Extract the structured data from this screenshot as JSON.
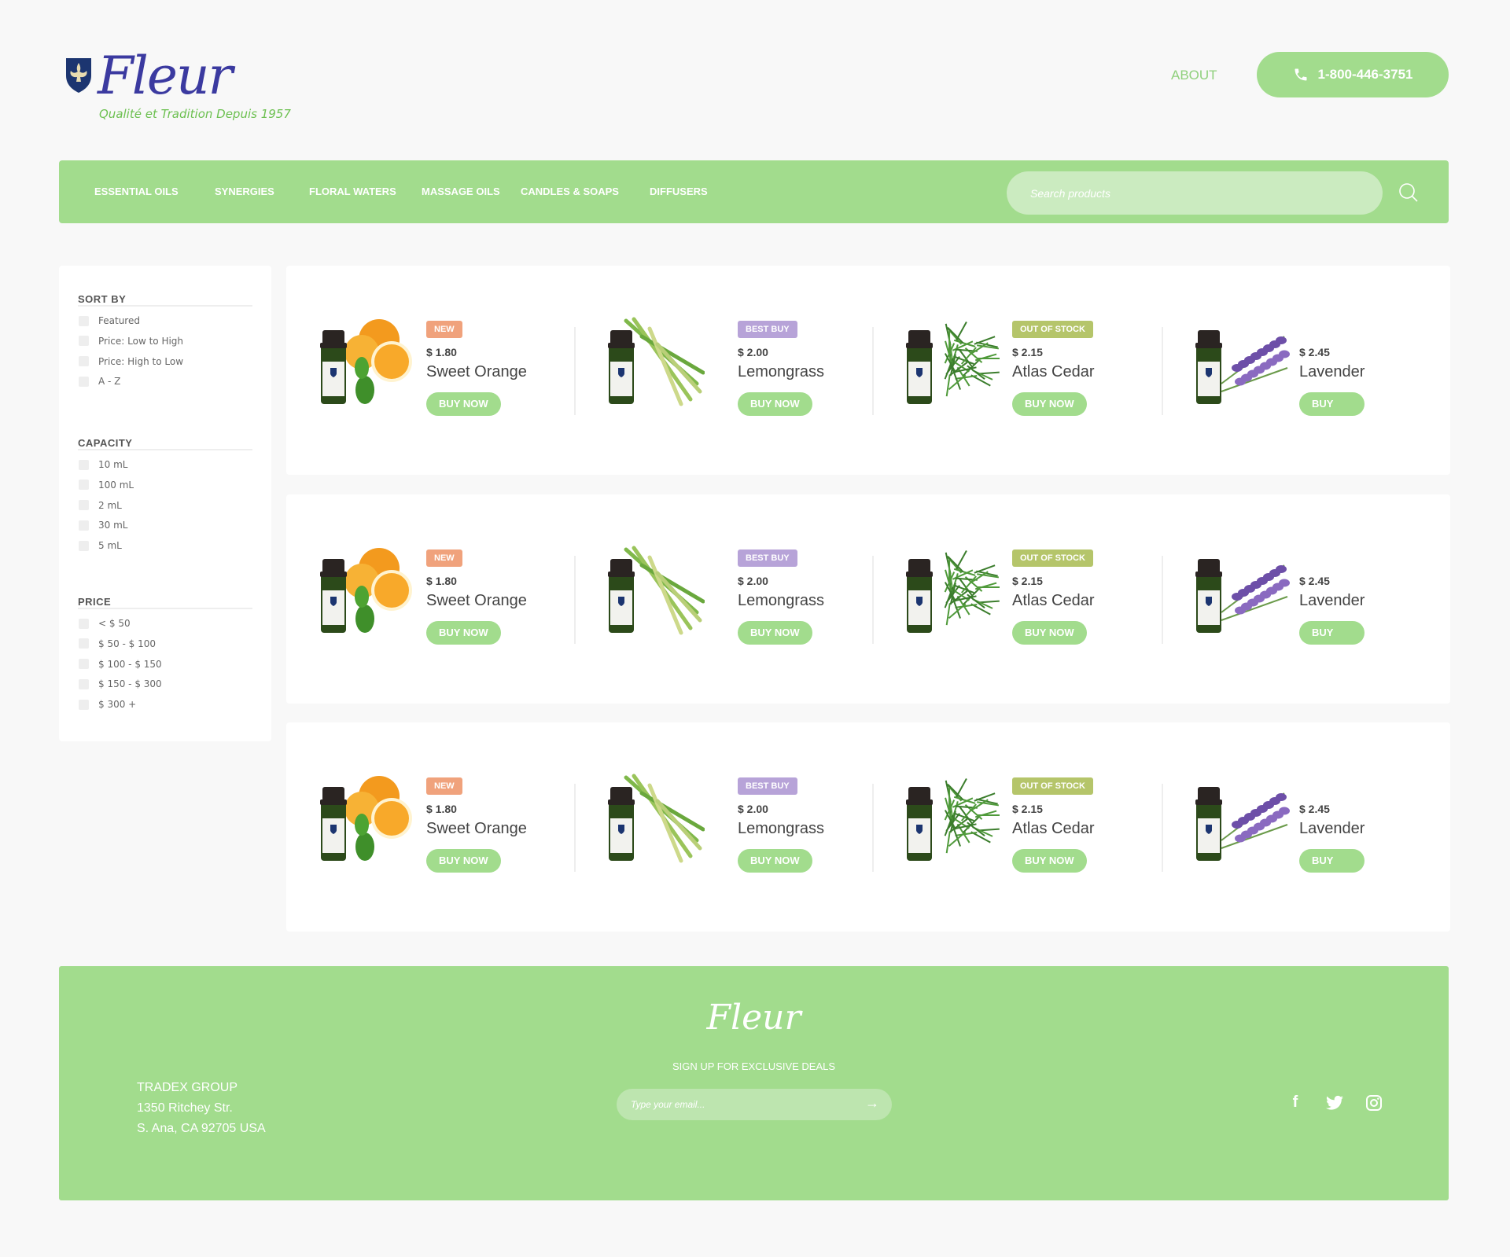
{
  "brand": {
    "logo": "Fleur",
    "tagline": "Qualité et Tradition Depuis 1957"
  },
  "header": {
    "about": "ABOUT",
    "phone": "1-800-446-3751"
  },
  "nav": {
    "items": [
      "ESSENTIAL OILS",
      "SYNERGIES",
      "FLORAL WATERS",
      "MASSAGE OILS",
      "CANDLES & SOAPS",
      "DIFFUSERS"
    ],
    "search_placeholder": "Search products"
  },
  "sidebar": {
    "sort": {
      "title": "SORT BY",
      "options": [
        "Featured",
        "Price: Low to High",
        "Price: High to Low",
        "A - Z"
      ]
    },
    "capacity": {
      "title": "CAPACITY",
      "options": [
        "10 mL",
        "100 mL",
        "2 mL",
        "30 mL",
        "5 mL"
      ]
    },
    "price": {
      "title": "PRICE",
      "options": [
        "< $ 50",
        "$ 50 - $ 100",
        "$ 100 - $ 150",
        "$ 150 - $ 300",
        "$ 300 +"
      ]
    }
  },
  "colors": {
    "accent": "#a2dc8d",
    "new": "#f0a27c",
    "best_buy": "#b7a3d8",
    "out_of_stock": "#b5c56a"
  },
  "rows": [
    [
      {
        "badge": "NEW",
        "badge_type": "new",
        "price": "$ 1.80",
        "name": "Sweet Orange",
        "buy": "BUY NOW",
        "img": "orange"
      },
      {
        "badge": "BEST BUY",
        "badge_type": "best_buy",
        "price": "$ 2.00",
        "name": "Lemongrass",
        "buy": "BUY NOW",
        "img": "lemongrass"
      },
      {
        "badge": "OUT OF STOCK",
        "badge_type": "out_of_stock",
        "price": "$ 2.15",
        "name": "Atlas Cedar",
        "buy": "BUY NOW",
        "img": "cedar"
      },
      {
        "badge": null,
        "badge_type": null,
        "price": "$ 2.45",
        "name": "Lavender",
        "buy": "BUY NOW",
        "img": "lavender"
      }
    ],
    [
      {
        "badge": "NEW",
        "badge_type": "new",
        "price": "$ 1.80",
        "name": "Sweet Orange",
        "buy": "BUY NOW",
        "img": "orange"
      },
      {
        "badge": "BEST BUY",
        "badge_type": "best_buy",
        "price": "$ 2.00",
        "name": "Lemongrass",
        "buy": "BUY NOW",
        "img": "lemongrass"
      },
      {
        "badge": "OUT OF STOCK",
        "badge_type": "out_of_stock",
        "price": "$ 2.15",
        "name": "Atlas Cedar",
        "buy": "BUY NOW",
        "img": "cedar"
      },
      {
        "badge": null,
        "badge_type": null,
        "price": "$ 2.45",
        "name": "Lavender",
        "buy": "BUY NOW",
        "img": "lavender"
      }
    ],
    [
      {
        "badge": "NEW",
        "badge_type": "new",
        "price": "$ 1.80",
        "name": "Sweet Orange",
        "buy": "BUY NOW",
        "img": "orange"
      },
      {
        "badge": "BEST BUY",
        "badge_type": "best_buy",
        "price": "$ 2.00",
        "name": "Lemongrass",
        "buy": "BUY NOW",
        "img": "lemongrass"
      },
      {
        "badge": "OUT OF STOCK",
        "badge_type": "out_of_stock",
        "price": "$ 2.15",
        "name": "Atlas Cedar",
        "buy": "BUY NOW",
        "img": "cedar"
      },
      {
        "badge": null,
        "badge_type": null,
        "price": "$ 2.45",
        "name": "Lavender",
        "buy": "BUY NOW",
        "img": "lavender"
      }
    ]
  ],
  "footer": {
    "logo": "Fleur",
    "address": [
      "TRADEX GROUP",
      "1350 Ritchey Str.",
      "S. Ana, CA 92705 USA"
    ],
    "signup": "SIGN UP FOR  EXCLUSIVE DEALS",
    "email_placeholder": "Type your email..."
  }
}
